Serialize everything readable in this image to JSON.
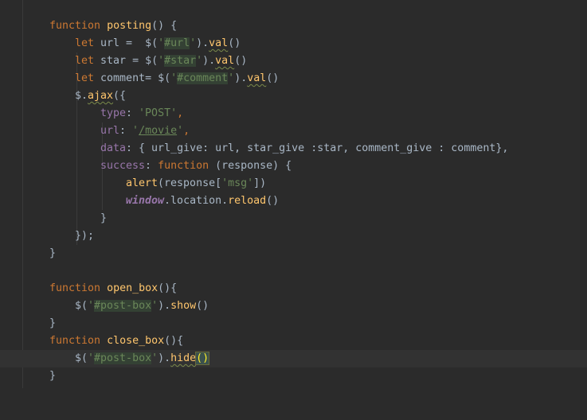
{
  "colors": {
    "background": "#2b2b2b",
    "keyword": "#cc7832",
    "function": "#ffc66d",
    "string": "#6a8759",
    "property": "#9876aa",
    "text": "#a9b7c6"
  },
  "code": {
    "l1": {
      "kw": "function",
      "name": "posting",
      "rest": "() {"
    },
    "l2": {
      "kw": "let",
      "a": " url =  ",
      "b": "$(",
      "q1": "'",
      "sel": "#url",
      "q2": "'",
      "c": ").",
      "m": "val",
      "d": "()"
    },
    "l3": {
      "kw": "let",
      "a": " star = ",
      "b": "$(",
      "q1": "'",
      "sel": "#star",
      "q2": "'",
      "c": ").",
      "m": "val",
      "d": "()"
    },
    "l4": {
      "kw": "let",
      "a": " comment= ",
      "b": "$(",
      "q1": "'",
      "sel": "#comment",
      "q2": "'",
      "c": ").",
      "m": "val",
      "d": "()"
    },
    "l5": {
      "a": "$.",
      "m": "ajax",
      "b": "({"
    },
    "l6": {
      "p": "type",
      "a": ": ",
      "s": "'POST'",
      "c": ","
    },
    "l7": {
      "p": "url",
      "a": ": ",
      "q1": "'",
      "s": "/movie",
      "q2": "'",
      "c": ","
    },
    "l8": {
      "p": "data",
      "a": ": { url_give: url, star_give :star, comment_give : comment},"
    },
    "l9": {
      "p": "success",
      "a": ": ",
      "kw": "function",
      "b": " (response) {"
    },
    "l10": {
      "fn": "alert",
      "a": "(response[",
      "s": "'msg'",
      "b": "])"
    },
    "l11": {
      "g": "window",
      "a": ".location.",
      "fn": "reload",
      "b": "()"
    },
    "l12": {
      "a": "}"
    },
    "l13": {
      "a": "});"
    },
    "l14": {
      "a": "}"
    },
    "l15": {
      "kw": "function",
      "name": "open_box",
      "rest": "(){"
    },
    "l16": {
      "a": "$(",
      "q1": "'",
      "sel": "#post-box",
      "q2": "'",
      "c": ").",
      "fn": "show",
      "d": "()"
    },
    "l17": {
      "a": "}"
    },
    "l18": {
      "kw": "function",
      "name": "close_box",
      "rest": "(){"
    },
    "l19": {
      "a": "$(",
      "q1": "'",
      "sel": "#post-box",
      "q2": "'",
      "c": ").",
      "fn": "hide",
      "d": "()"
    },
    "l20": {
      "a": "}"
    }
  }
}
